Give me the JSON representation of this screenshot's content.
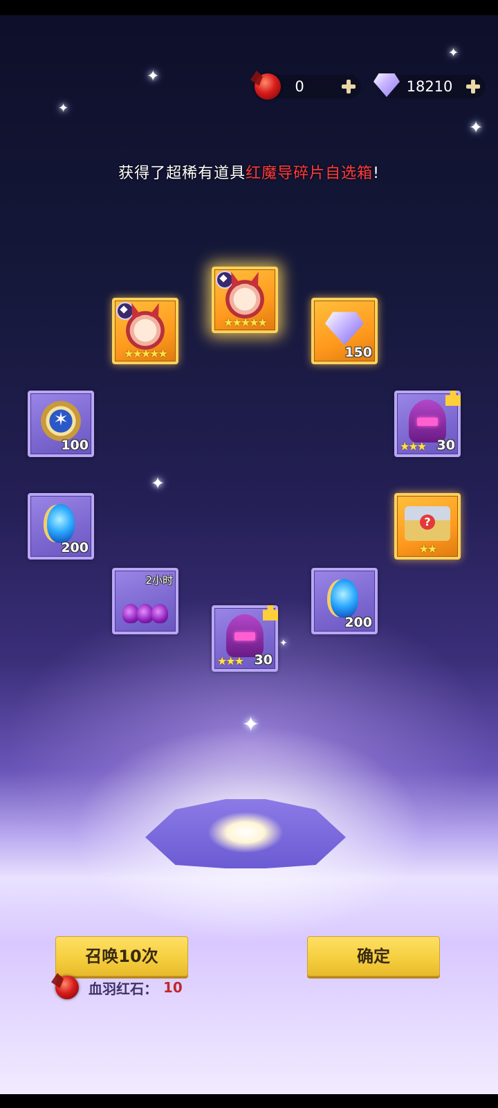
{
  "currencies": {
    "ruby": {
      "icon": "blood-feather-ruby-icon",
      "value": "0"
    },
    "diamond": {
      "icon": "diamond-icon",
      "value": "18210"
    }
  },
  "announcement": {
    "prefix": "获得了超稀有道具",
    "item": "红魔导碎片自选箱",
    "suffix": "!"
  },
  "rewards": [
    {
      "name": "red-demon-hero-shard",
      "icon": "hero-portrait-icon",
      "stars": "★★★★★",
      "frame": "gold"
    },
    {
      "name": "red-demon-hero-shard",
      "icon": "hero-portrait-icon",
      "stars": "★★★★★",
      "frame": "gold"
    },
    {
      "name": "diamond",
      "icon": "diamond-icon",
      "quantity": "150",
      "frame": "gold"
    },
    {
      "name": "star-medal",
      "icon": "star-medal-icon",
      "quantity": "100",
      "frame": "purple"
    },
    {
      "name": "helmet-shard",
      "icon": "helmet-icon",
      "stars": "★★★",
      "quantity": "30",
      "frame": "purple"
    },
    {
      "name": "blue-egg",
      "icon": "blue-egg-icon",
      "quantity": "200",
      "frame": "purple"
    },
    {
      "name": "equipment-chest",
      "icon": "mystery-chest-icon",
      "stars": "★★",
      "frame": "gold"
    },
    {
      "name": "potion-pack",
      "icon": "potion-icon",
      "timer": "2小时",
      "frame": "purple"
    },
    {
      "name": "blue-egg",
      "icon": "blue-egg-icon",
      "quantity": "200",
      "frame": "purple"
    },
    {
      "name": "helmet-shard",
      "icon": "helmet-icon",
      "stars": "★★★",
      "quantity": "30",
      "frame": "purple"
    }
  ],
  "buttons": {
    "summon10": "召唤10次",
    "confirm": "确定"
  },
  "cost": {
    "icon": "blood-feather-ruby-icon",
    "label": "血羽红石",
    "separator": "：",
    "value": "10"
  },
  "colors": {
    "highlight": "#ff3b3b",
    "button": "#f5cf3f",
    "gold_frame": "#ffd15a",
    "purple_frame": "#b9a7f5"
  }
}
